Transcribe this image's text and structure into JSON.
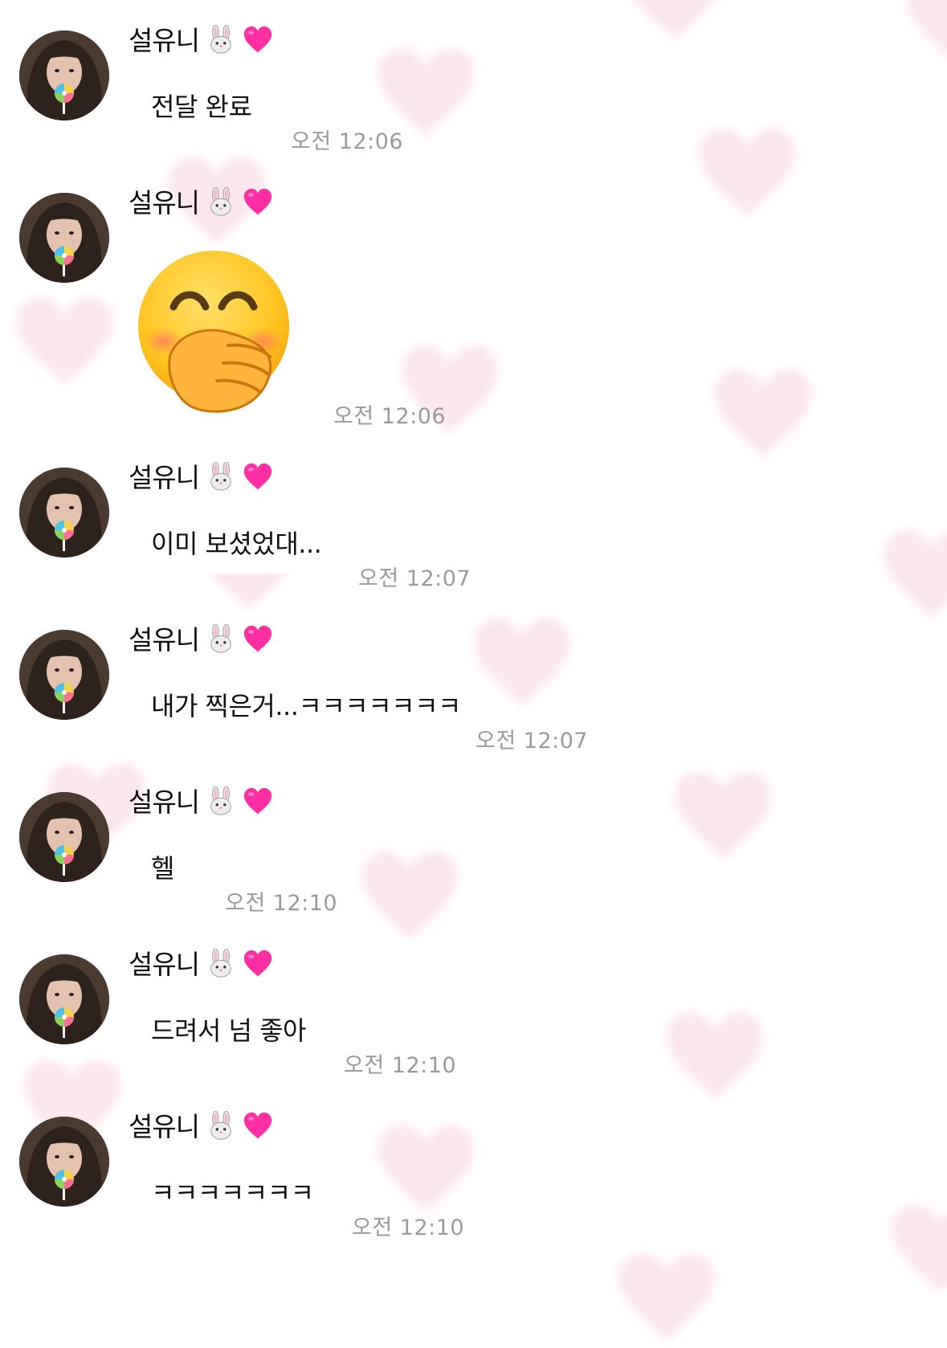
{
  "sender": {
    "name": "설유니",
    "name_icons": [
      "rabbit-face-icon",
      "pink-heart-icon"
    ]
  },
  "messages": [
    {
      "type": "text",
      "text": "전달 완료",
      "time": "오전 12:06"
    },
    {
      "type": "emoji",
      "emoji": "face-with-hand-over-mouth",
      "time": "오전 12:06"
    },
    {
      "type": "text",
      "text": "이미 보셨었대...",
      "time": "오전 12:07"
    },
    {
      "type": "text",
      "text": "내가 찍은거...ㅋㅋㅋㅋㅋㅋㅋ",
      "time": "오전 12:07"
    },
    {
      "type": "text",
      "text": "헬",
      "time": "오전 12:10"
    },
    {
      "type": "text",
      "text": "드려서 넘 좋아",
      "time": "오전 12:10"
    },
    {
      "type": "text",
      "text": "ㅋㅋㅋㅋㅋㅋㅋ",
      "time": "오전 12:10"
    }
  ],
  "colors": {
    "background": "#ffffff",
    "heart_pattern": "#fbe3ea",
    "bubble": "#ffffff",
    "timestamp": "#9a9a9a",
    "heart_icon": "#ff2fa3"
  }
}
